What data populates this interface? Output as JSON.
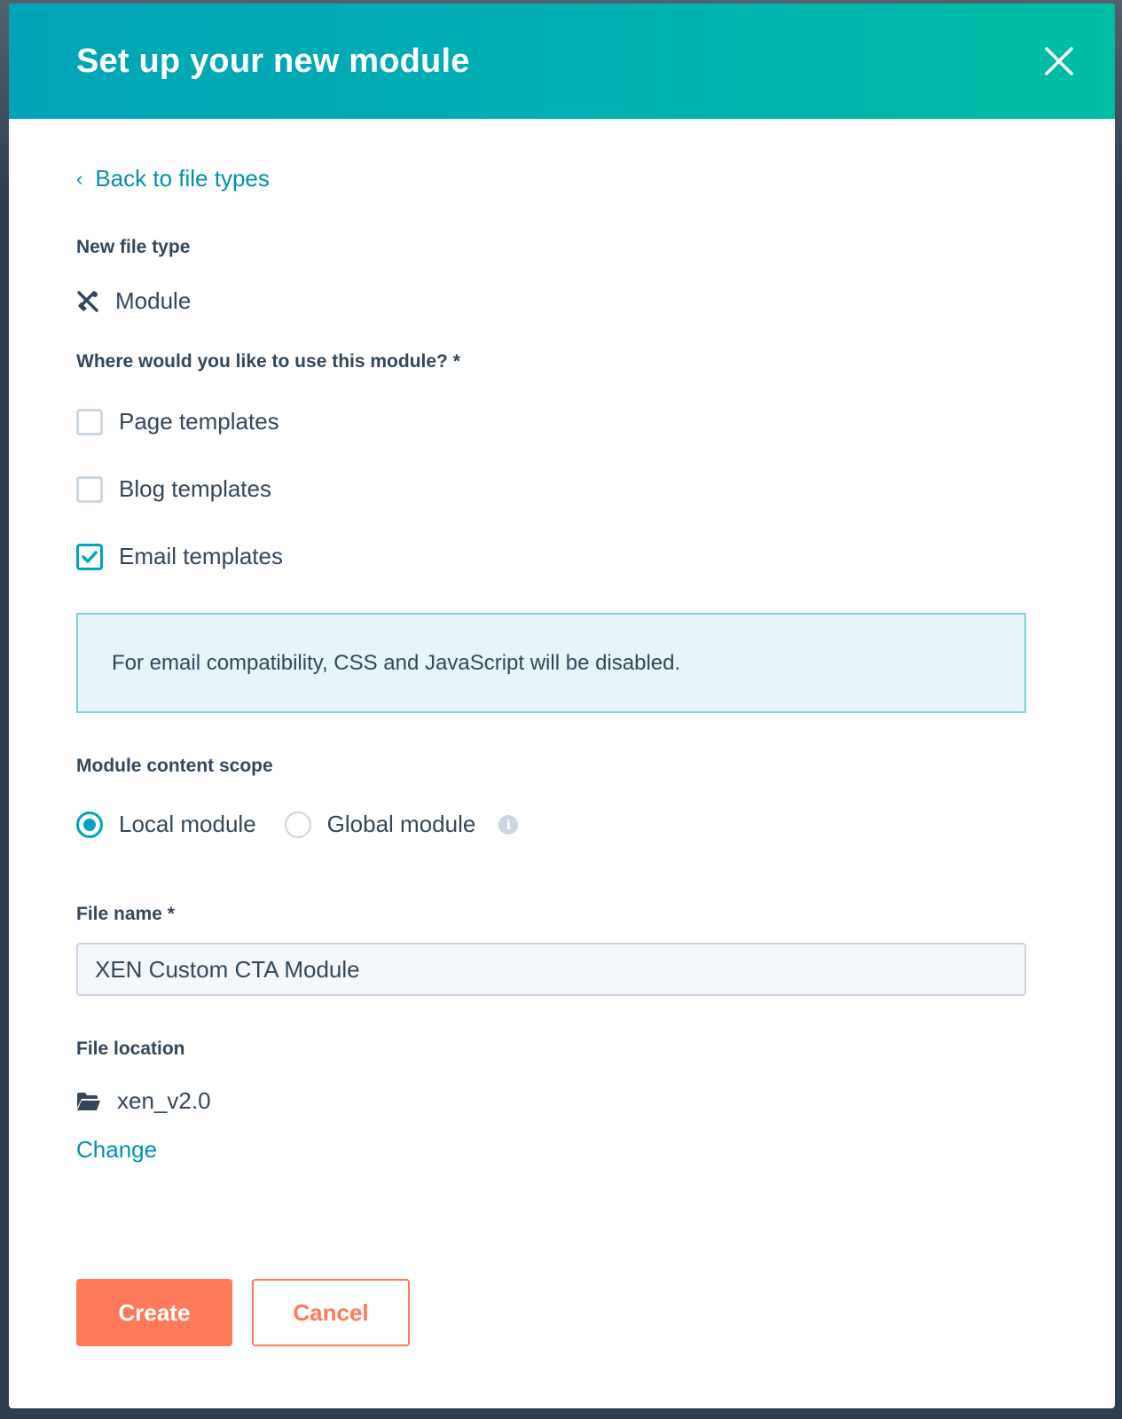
{
  "modal": {
    "title": "Set up your new module",
    "close_icon": "close-icon"
  },
  "back_link": {
    "chevron": "‹",
    "label": "Back to file types"
  },
  "file_type": {
    "label": "New file type",
    "icon": "tools-icon",
    "value": "Module"
  },
  "usage": {
    "label": "Where would you like to use this module? *",
    "options": [
      {
        "label": "Page templates",
        "checked": false
      },
      {
        "label": "Blog templates",
        "checked": false
      },
      {
        "label": "Email templates",
        "checked": true
      }
    ]
  },
  "notice": {
    "text": "For email compatibility, CSS and JavaScript will be disabled."
  },
  "scope": {
    "label": "Module content scope",
    "options": [
      {
        "label": "Local module",
        "selected": true
      },
      {
        "label": "Global module",
        "selected": false
      }
    ],
    "info_icon": "i"
  },
  "file_name": {
    "label": "File name *",
    "value": "XEN Custom CTA Module"
  },
  "file_location": {
    "label": "File location",
    "folder": "xen_v2.0",
    "change_label": "Change"
  },
  "actions": {
    "create_label": "Create",
    "cancel_label": "Cancel"
  },
  "colors": {
    "header_start": "#00a4b6",
    "header_end": "#00bda5",
    "link": "#0091ae",
    "primary_button": "#ff7a59",
    "text": "#33475b",
    "checkbox_accent": "#00a4bd",
    "notice_bg": "#e5f5f8"
  }
}
